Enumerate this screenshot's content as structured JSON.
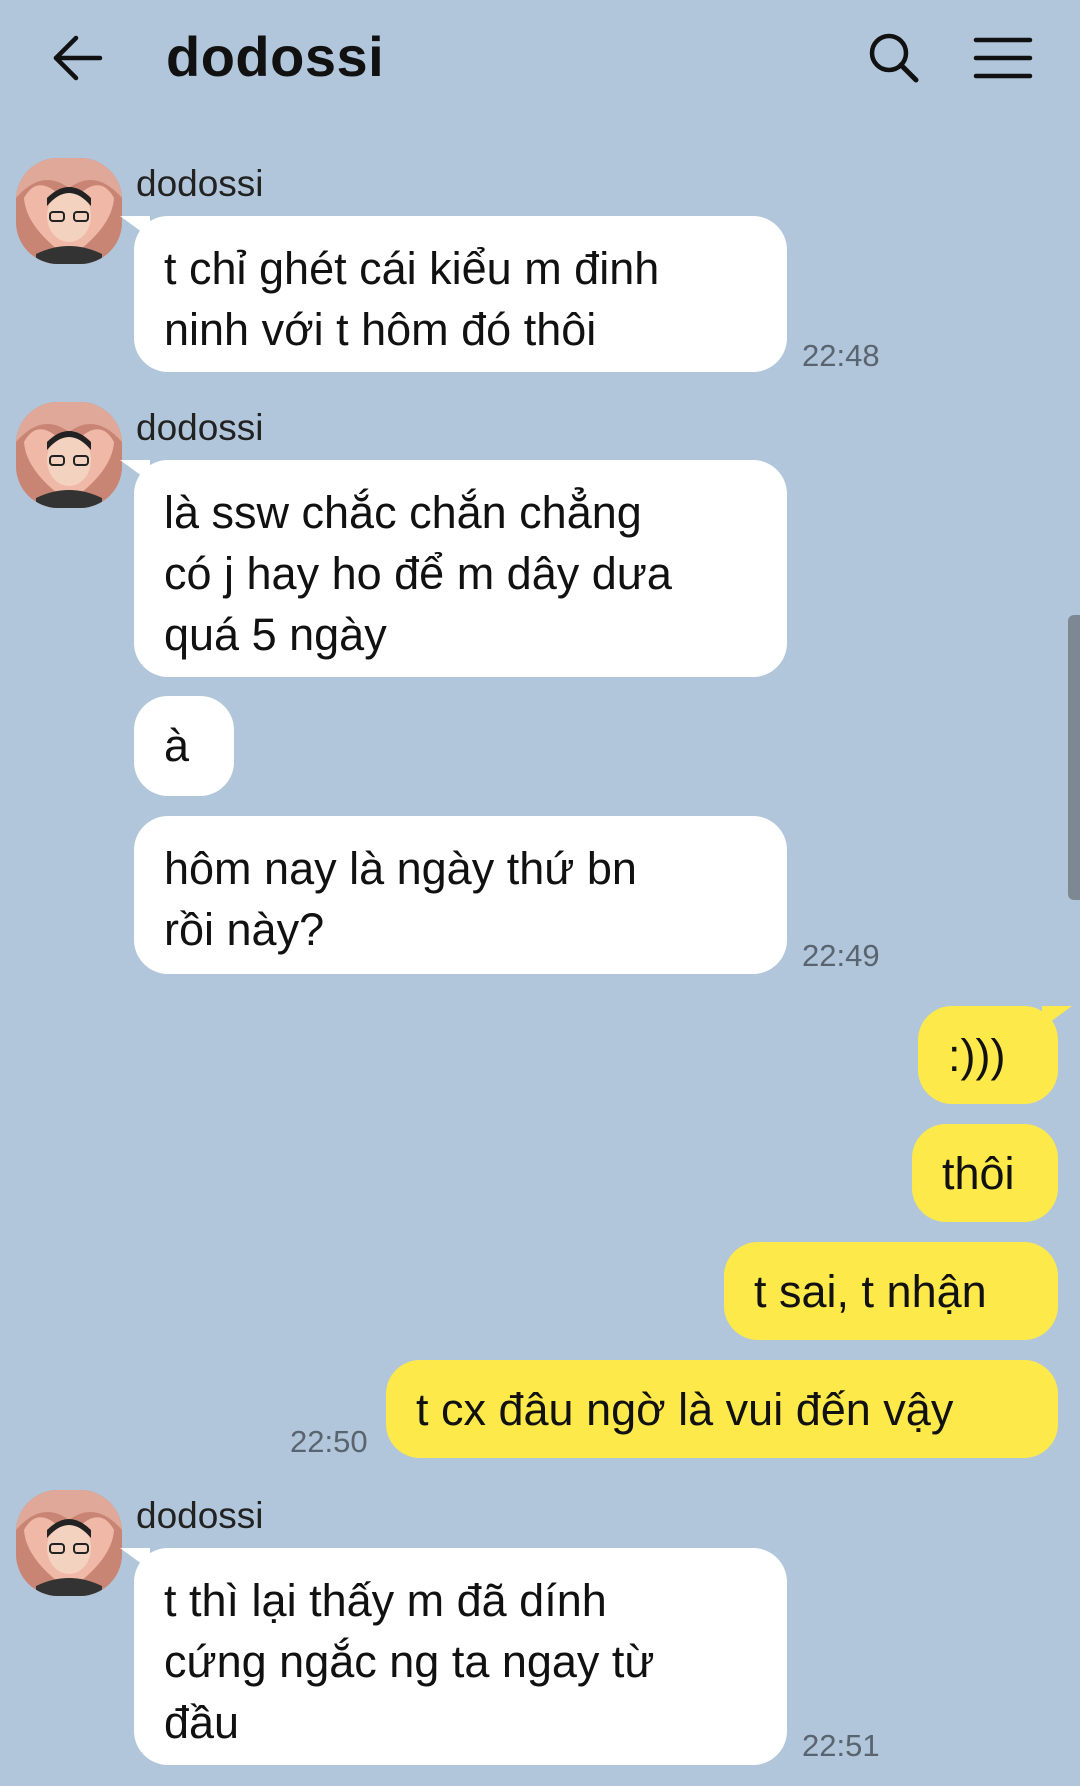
{
  "header": {
    "title": "dodossi",
    "back_icon": "arrow-left-icon",
    "search_icon": "search-icon",
    "menu_icon": "hamburger-menu-icon"
  },
  "colors": {
    "background": "#b1c6da",
    "incoming_bubble": "#ffffff",
    "outgoing_bubble": "#fde949"
  },
  "messages": [
    {
      "sender": "dodossi",
      "direction": "in",
      "lines": [
        "t chỉ ghét cái kiểu m đinh",
        "ninh với t hôm đó thôi"
      ],
      "time": "22:48"
    },
    {
      "sender": "dodossi",
      "direction": "in",
      "lines": [
        "là ssw chắc chắn chẳng",
        "có j hay ho để m dây dưa",
        "quá 5 ngày"
      ]
    },
    {
      "direction": "in",
      "lines": [
        "à"
      ]
    },
    {
      "direction": "in",
      "lines": [
        "hôm nay là ngày thứ bn",
        "rồi này?"
      ],
      "time": "22:49"
    },
    {
      "direction": "out",
      "text": ":)))"
    },
    {
      "direction": "out",
      "text": "thôi"
    },
    {
      "direction": "out",
      "text": "t sai, t nhận"
    },
    {
      "direction": "out",
      "text": "t cx đâu ngờ là vui đến vậy",
      "time": "22:50"
    },
    {
      "sender": "dodossi",
      "direction": "in",
      "lines": [
        "t thì lại thấy m đã dính",
        "cứng ngắc ng ta ngay từ",
        "đầu"
      ],
      "time": "22:51"
    }
  ]
}
